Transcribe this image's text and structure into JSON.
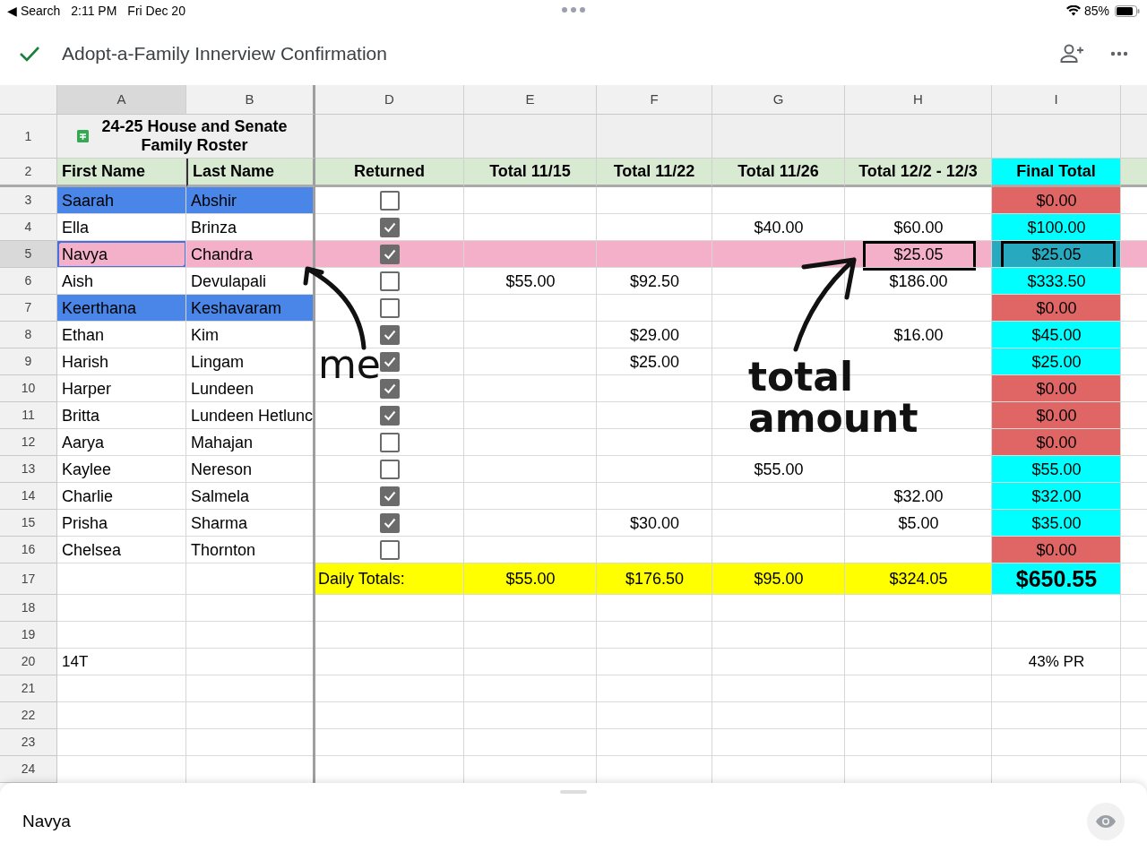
{
  "status_bar": {
    "back": "◀ Search",
    "time": "2:11 PM",
    "date": "Fri Dec 20",
    "battery": "85%"
  },
  "toolbar": {
    "title": "Adopt-a-Family Innerview Confirmation"
  },
  "columns": [
    {
      "label": "A",
      "selected": true
    },
    {
      "label": "B",
      "selected": false
    },
    {
      "label": "D",
      "selected": false
    },
    {
      "label": "E",
      "selected": false
    },
    {
      "label": "F",
      "selected": false
    },
    {
      "label": "G",
      "selected": false
    },
    {
      "label": "H",
      "selected": false
    },
    {
      "label": "I",
      "selected": false
    }
  ],
  "title_row": {
    "number": "1",
    "text": "24-25 House and Senate Family Roster"
  },
  "header_row": {
    "number": "2",
    "cells": [
      "First Name",
      "Last Name",
      "Returned",
      "Total 11/15",
      "Total 11/22",
      "Total 11/26",
      "Total 12/2 - 12/3"
    ],
    "final": "Final Total"
  },
  "rows": [
    {
      "number": "3",
      "first": "Saarah",
      "last": "Abshir",
      "color": "#4a86e8",
      "returned": false,
      "amounts": {},
      "final": {
        "text": "$0.00",
        "color": "#e06666"
      },
      "selected": false,
      "highlighted": false,
      "boxed": false
    },
    {
      "number": "4",
      "first": "Ella",
      "last": "Brinza",
      "returned": true,
      "amounts": {
        "G": "$40.00",
        "H": "$60.00"
      },
      "final": {
        "text": "$100.00",
        "color": "#00ffff"
      },
      "selected": false,
      "highlighted": false,
      "boxed": false
    },
    {
      "number": "5",
      "first": "Navya",
      "last": "Chandra",
      "returned": true,
      "amounts": {
        "H": "$25.05"
      },
      "final": {
        "text": "$25.05",
        "color": "#27a9bf"
      },
      "selected": true,
      "highlighted": true,
      "boxed": true
    },
    {
      "number": "6",
      "first": "Aish",
      "last": "Devulapali",
      "returned": false,
      "amounts": {
        "E": "$55.00",
        "F": "$92.50",
        "H": "$186.00"
      },
      "final": {
        "text": "$333.50",
        "color": "#00ffff"
      },
      "selected": false,
      "highlighted": false,
      "boxed": false
    },
    {
      "number": "7",
      "first": "Keerthana",
      "last": "Keshavaram",
      "color": "#4a86e8",
      "returned": false,
      "amounts": {},
      "final": {
        "text": "$0.00",
        "color": "#e06666"
      },
      "selected": false,
      "highlighted": false,
      "boxed": false
    },
    {
      "number": "8",
      "first": "Ethan",
      "last": "Kim",
      "returned": true,
      "amounts": {
        "F": "$29.00",
        "H": "$16.00"
      },
      "final": {
        "text": "$45.00",
        "color": "#00ffff"
      },
      "selected": false,
      "highlighted": false,
      "boxed": false
    },
    {
      "number": "9",
      "first": "Harish",
      "last": "Lingam",
      "returned": true,
      "amounts": {
        "F": "$25.00"
      },
      "final": {
        "text": "$25.00",
        "color": "#00ffff"
      },
      "selected": false,
      "highlighted": false,
      "boxed": false
    },
    {
      "number": "10",
      "first": "Harper",
      "last": "Lundeen",
      "returned": true,
      "amounts": {},
      "final": {
        "text": "$0.00",
        "color": "#e06666"
      },
      "selected": false,
      "highlighted": false,
      "boxed": false
    },
    {
      "number": "11",
      "first": "Britta",
      "last": "Lundeen Hetlunc",
      "returned": true,
      "amounts": {},
      "final": {
        "text": "$0.00",
        "color": "#e06666"
      },
      "selected": false,
      "highlighted": false,
      "boxed": false
    },
    {
      "number": "12",
      "first": "Aarya",
      "last": "Mahajan",
      "returned": false,
      "amounts": {},
      "final": {
        "text": "$0.00",
        "color": "#e06666"
      },
      "selected": false,
      "highlighted": false,
      "boxed": false
    },
    {
      "number": "13",
      "first": "Kaylee",
      "last": "Nereson",
      "returned": false,
      "amounts": {
        "G": "$55.00"
      },
      "final": {
        "text": "$55.00",
        "color": "#00ffff"
      },
      "selected": false,
      "highlighted": false,
      "boxed": false
    },
    {
      "number": "14",
      "first": "Charlie",
      "last": "Salmela",
      "returned": true,
      "amounts": {
        "H": "$32.00"
      },
      "final": {
        "text": "$32.00",
        "color": "#00ffff"
      },
      "selected": false,
      "highlighted": false,
      "boxed": false
    },
    {
      "number": "15",
      "first": "Prisha",
      "last": "Sharma",
      "returned": true,
      "amounts": {
        "F": "$30.00",
        "H": "$5.00"
      },
      "final": {
        "text": "$35.00",
        "color": "#00ffff"
      },
      "selected": false,
      "highlighted": false,
      "boxed": false
    },
    {
      "number": "16",
      "first": "Chelsea",
      "last": "Thornton",
      "returned": false,
      "amounts": {},
      "final": {
        "text": "$0.00",
        "color": "#e06666"
      },
      "selected": false,
      "highlighted": false,
      "boxed": false
    }
  ],
  "totals_row": {
    "number": "17",
    "label": "Daily Totals:",
    "amounts": {
      "E": "$55.00",
      "F": "$176.50",
      "G": "$95.00",
      "H": "$324.05"
    },
    "final": "$650.55"
  },
  "extra_rows": [
    {
      "number": "18",
      "cells": {}
    },
    {
      "number": "19",
      "cells": {}
    },
    {
      "number": "20",
      "cells": {
        "A": "14T",
        "I": "43% PR"
      }
    },
    {
      "number": "21",
      "cells": {}
    },
    {
      "number": "22",
      "cells": {}
    },
    {
      "number": "23",
      "cells": {}
    },
    {
      "number": "24",
      "cells": {}
    }
  ],
  "ink_notes": [
    "me",
    "total amount"
  ],
  "cell_editor": {
    "value": "Navya"
  }
}
